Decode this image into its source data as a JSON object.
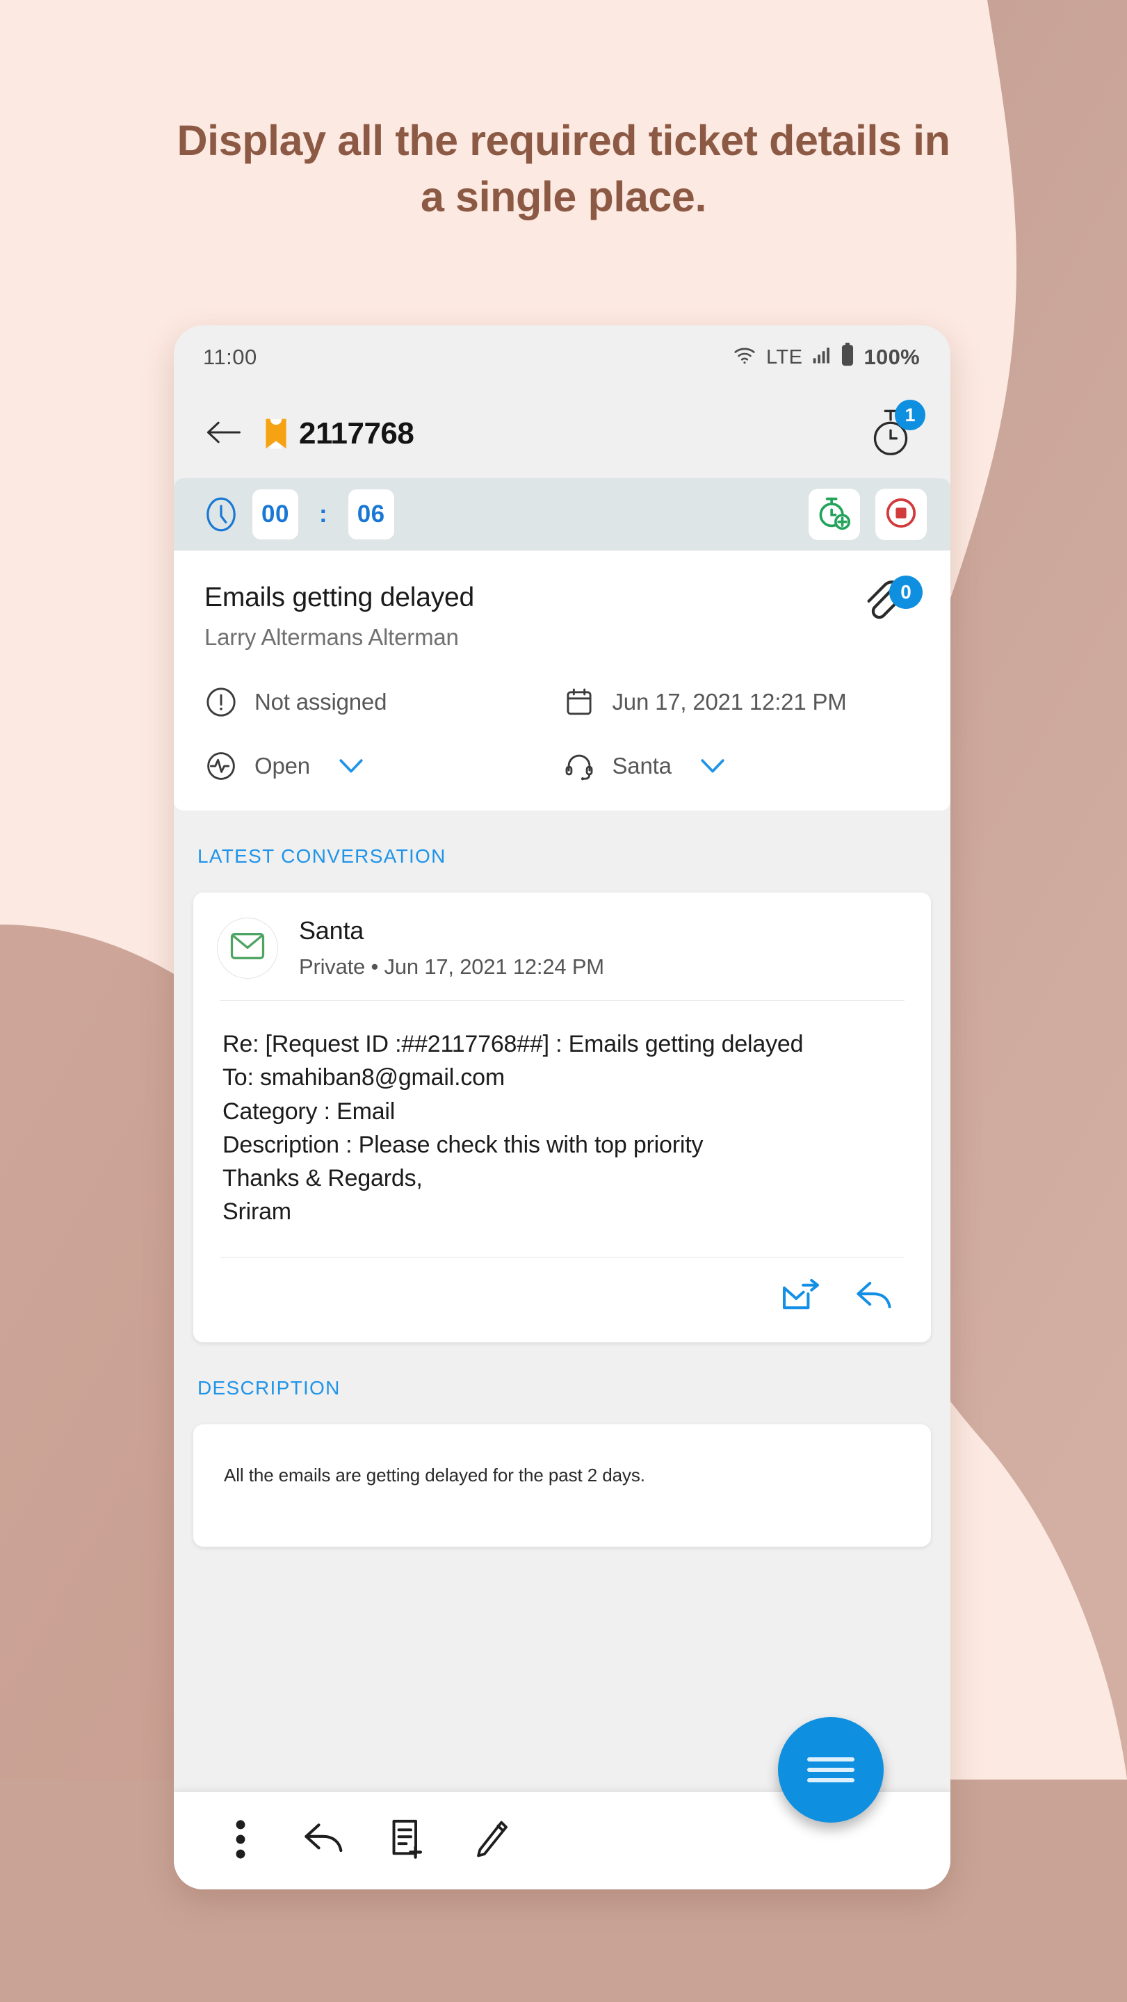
{
  "headline": "Display all the required ticket details in a single place.",
  "colors": {
    "bg_light": "#fce9e1",
    "bg_blob": "#c9a496",
    "headline": "#8c5a44",
    "accent_blue": "#0f8fe0",
    "link_blue": "#1f94e8",
    "timer_bar": "#dee5e6",
    "ticket_orange": "#f5a313",
    "green": "#22a35c",
    "red": "#d23b3b"
  },
  "statusbar": {
    "time": "11:00",
    "network": "LTE",
    "battery": "100%",
    "wifi_icon": "wifi-icon",
    "signal_icon": "cellular-signal-icon",
    "battery_icon": "battery-full-icon"
  },
  "appbar": {
    "back_icon": "back-arrow-icon",
    "ticket_icon": "ticket-bookmark-icon",
    "ticket_id": "2117768",
    "timer_icon": "stopwatch-icon",
    "timer_badge": "1"
  },
  "timerbar": {
    "clock_icon": "clock-icon",
    "minutes": "00",
    "separator": ":",
    "seconds": "06",
    "add_timer_icon": "stopwatch-add-icon",
    "stop_icon": "stop-recording-icon"
  },
  "detail": {
    "title": "Emails getting delayed",
    "requester": "Larry Altermans Alterman",
    "attachment_icon": "paperclip-icon",
    "attachment_count": "0",
    "meta": [
      {
        "icon": "alert-circle-icon",
        "label": "Not assigned",
        "chevron": false
      },
      {
        "icon": "calendar-icon",
        "label": "Jun 17, 2021 12:21 PM",
        "chevron": false
      },
      {
        "icon": "pulse-status-icon",
        "label": "Open",
        "chevron": true
      },
      {
        "icon": "headset-agent-icon",
        "label": "Santa",
        "chevron": true
      }
    ]
  },
  "conversation": {
    "section_label": "LATEST CONVERSATION",
    "avatar_icon": "email-envelope-icon",
    "sender": "Santa",
    "meta": "Private • Jun 17, 2021 12:24 PM",
    "body": "Re: [Request ID :##2117768##] : Emails getting delayed\nTo: smahiban8@gmail.com\nCategory : Email\nDescription : Please check this with top priority\nThanks & Regards,\nSriram",
    "actions": [
      {
        "icon": "forward-email-icon"
      },
      {
        "icon": "reply-icon"
      }
    ]
  },
  "description": {
    "section_label": "DESCRIPTION",
    "text": "All the emails are getting delayed for the past 2 days."
  },
  "bottombar": {
    "items": [
      {
        "icon": "more-vertical-icon"
      },
      {
        "icon": "reply-icon"
      },
      {
        "icon": "add-note-icon"
      },
      {
        "icon": "edit-pencil-icon"
      }
    ],
    "fab_icon": "menu-hamburger-icon"
  }
}
